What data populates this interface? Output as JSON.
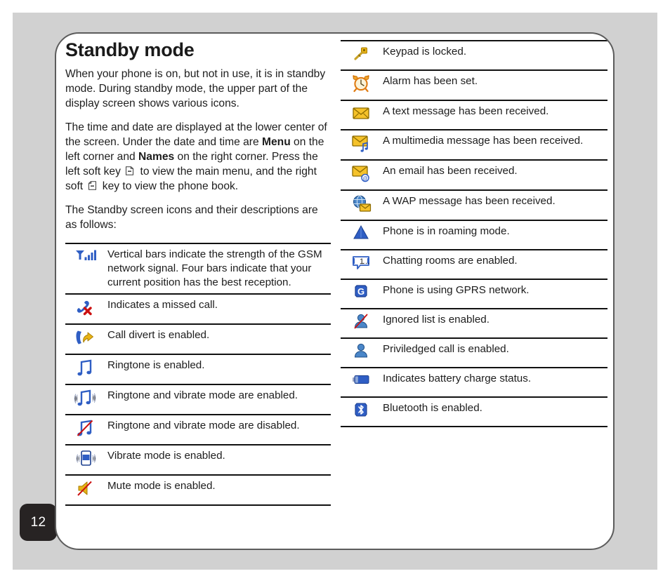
{
  "page": {
    "number": "12",
    "title": "Standby mode"
  },
  "intro": {
    "para1": "When your phone is on, but not in use, it is in standby mode. During standby mode, the upper part of the display screen shows various icons.",
    "para2_part1": "The time and date are displayed at the lower center of the screen. Under the date and time are ",
    "para2_bold1": "Menu",
    "para2_part2": " on the left corner and ",
    "para2_bold2": "Names",
    "para2_part3": " on the right corner. Press the left soft key ",
    "para2_part4": " to view the main menu, and the right soft ",
    "para2_part5": " key to view the phone book.",
    "para3": "The Standby screen icons and their descriptions are as follows:"
  },
  "icons_left": [
    {
      "icon": "signal-bars-icon",
      "description": "Vertical bars indicate the strength of the GSM network signal. Four bars indicate that your current position has the best reception."
    },
    {
      "icon": "missed-call-icon",
      "description": "Indicates a missed call."
    },
    {
      "icon": "call-divert-icon",
      "description": "Call divert is enabled."
    },
    {
      "icon": "ringtone-icon",
      "description": "Ringtone is enabled."
    },
    {
      "icon": "ringtone-vibrate-enabled-icon",
      "description": "Ringtone and vibrate mode are enabled."
    },
    {
      "icon": "ringtone-vibrate-disabled-icon",
      "description": "Ringtone and vibrate mode are disabled."
    },
    {
      "icon": "vibrate-icon",
      "description": "Vibrate mode is enabled."
    },
    {
      "icon": "mute-icon",
      "description": "Mute mode is enabled."
    }
  ],
  "icons_right": [
    {
      "icon": "keypad-lock-icon",
      "description": "Keypad is locked."
    },
    {
      "icon": "alarm-clock-icon",
      "description": "Alarm has been set."
    },
    {
      "icon": "text-message-icon",
      "description": "A text message has been received."
    },
    {
      "icon": "multimedia-message-icon",
      "description": "A multimedia message has been received."
    },
    {
      "icon": "email-icon",
      "description": "An email has been received."
    },
    {
      "icon": "wap-message-icon",
      "description": "A WAP message has been received."
    },
    {
      "icon": "roaming-icon",
      "description": "Phone is in roaming mode."
    },
    {
      "icon": "chat-room-icon",
      "description": "Chatting rooms are enabled."
    },
    {
      "icon": "gprs-icon",
      "description": "Phone is using GPRS network."
    },
    {
      "icon": "ignored-list-icon",
      "description": "Ignored list is enabled."
    },
    {
      "icon": "priviledged-call-icon",
      "description": "Priviledged call is enabled."
    },
    {
      "icon": "battery-icon",
      "description": "Indicates battery charge status."
    },
    {
      "icon": "bluetooth-icon",
      "description": "Bluetooth is enabled."
    }
  ],
  "colors": {
    "backdrop": "#d1d1d1",
    "page_border": "#5c5c5c",
    "badge_bg": "#272323",
    "icon_blue": "#2f5ec4",
    "icon_gold": "#e8b317",
    "rule": "#111111"
  }
}
